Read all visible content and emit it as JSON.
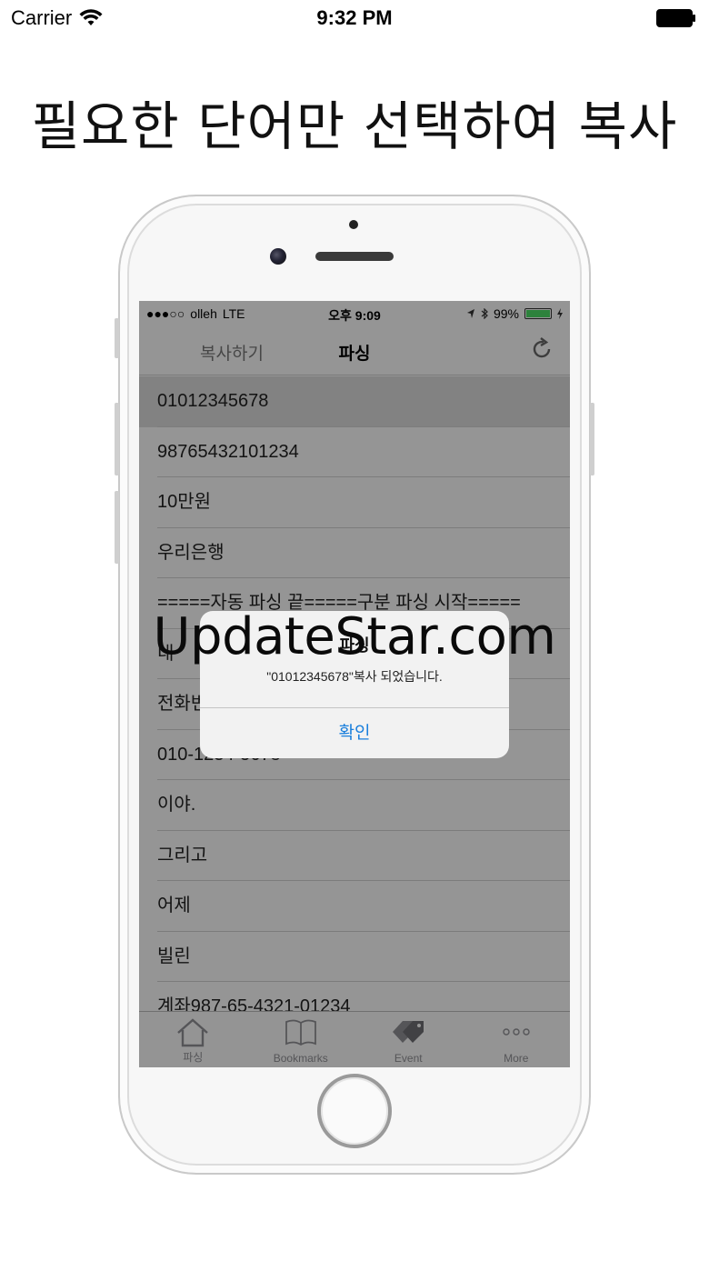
{
  "outer_status": {
    "carrier": "Carrier",
    "time": "9:32 PM"
  },
  "headline": "필요한 단어만 선택하여 복사",
  "phone_status": {
    "signal": "●●●○○",
    "carrier": "olleh",
    "network": "LTE",
    "time": "오후 9:09",
    "battery": "99%"
  },
  "nav": {
    "left_label": "복사하기",
    "title": "파싱",
    "refresh_icon": "refresh-icon"
  },
  "rows": [
    "01012345678",
    "98765432101234",
    "10만원",
    "우리은행",
    "=====자동 파싱 끝=====구분 파싱 시작=====",
    "내",
    "전화번",
    "010-1234-5678",
    "이야.",
    "그리고",
    "어제",
    "빌린",
    "계좌987-65-4321-01234"
  ],
  "selected_row": 0,
  "tabs": [
    {
      "label": "파싱",
      "icon": "home-icon"
    },
    {
      "label": "Bookmarks",
      "icon": "book-icon"
    },
    {
      "label": "Event",
      "icon": "tag-icon"
    },
    {
      "label": "More",
      "icon": "more-icon"
    }
  ],
  "alert": {
    "title": "파싱",
    "message": "\"01012345678\"복사 되었습니다.",
    "button": "확인"
  },
  "watermark": "UpdateStar.com",
  "colors": {
    "accent": "#1a7fdc",
    "battery": "#4cd964"
  }
}
